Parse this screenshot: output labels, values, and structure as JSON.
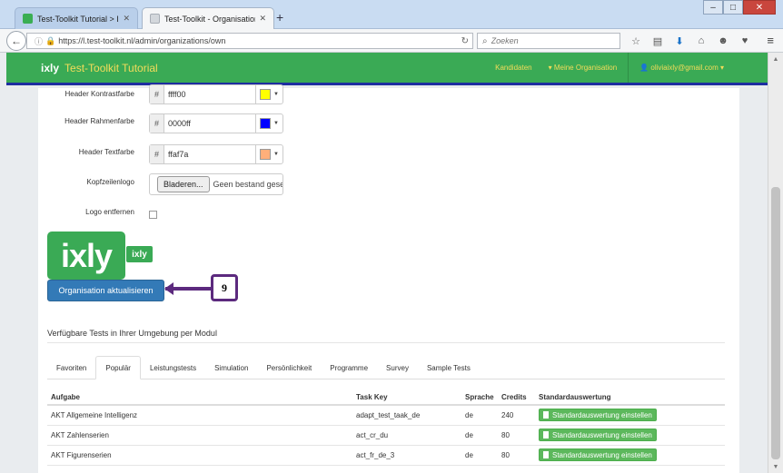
{
  "browser": {
    "tabs": [
      {
        "label": "Test-Toolkit Tutorial > Ixly",
        "close": "✕"
      },
      {
        "label": "Test-Toolkit - Organisation...",
        "close": "✕"
      }
    ],
    "new_tab": "+",
    "url_prefix": "https://",
    "url": "l.test-toolkit.nl/admin/organizations/own",
    "search_placeholder": "Zoeken"
  },
  "app": {
    "logo": "ixly",
    "name": "Test-Toolkit Tutorial",
    "nav": {
      "candidates": "Kandidaten",
      "my_org": "▾ Meine Organisation",
      "user": "oliviaixly@gmail.com ▾"
    }
  },
  "form": {
    "header_contrast": {
      "label": "Header Kontrastfarbe",
      "value": "ffff00",
      "swatch": "#ffff00"
    },
    "header_border": {
      "label": "Header Rahmenfarbe",
      "value": "0000ff",
      "swatch": "#0000ff"
    },
    "header_text": {
      "label": "Header Textfarbe",
      "value": "ffaf7a",
      "swatch": "#ffaf7a"
    },
    "header_logo": {
      "label": "Kopfzeilenlogo",
      "button": "Bladeren...",
      "filename": "Geen bestand geselecteerd."
    },
    "remove_logo": {
      "label": "Logo entfernen",
      "checked": false
    },
    "hash": "#"
  },
  "logo_preview": {
    "big": "ixly",
    "small": "ixly"
  },
  "update_button": "Organisation aktualisieren",
  "callout": {
    "number": "9"
  },
  "tests_section": {
    "title": "Verfügbare Tests in Ihrer Umgebung per Modul",
    "tabs": [
      "Favoriten",
      "Populär",
      "Leistungstests",
      "Simulation",
      "Persönlichkeit",
      "Programme",
      "Survey",
      "Sample Tests"
    ],
    "active_tab": "Populär",
    "columns": [
      "Aufgabe",
      "Task Key",
      "Sprache",
      "Credits",
      "Standardauswertung"
    ],
    "rows": [
      {
        "task": "AKT Allgemeine Intelligenz",
        "key": "adapt_test_taak_de",
        "lang": "de",
        "credits": "240",
        "action": "Standardauswertung einstellen"
      },
      {
        "task": "AKT Zahlenserien",
        "key": "act_cr_du",
        "lang": "de",
        "credits": "80",
        "action": "Standardauswertung einstellen"
      },
      {
        "task": "AKT Figurenserien",
        "key": "act_fr_de_3",
        "lang": "de",
        "credits": "80",
        "action": "Standardauswertung einstellen"
      }
    ]
  },
  "colors": {
    "brand_green": "#3aaa55",
    "nav_text": "#f3dc5a",
    "primary_blue": "#337ab7",
    "callout": "#5c2a7e"
  }
}
